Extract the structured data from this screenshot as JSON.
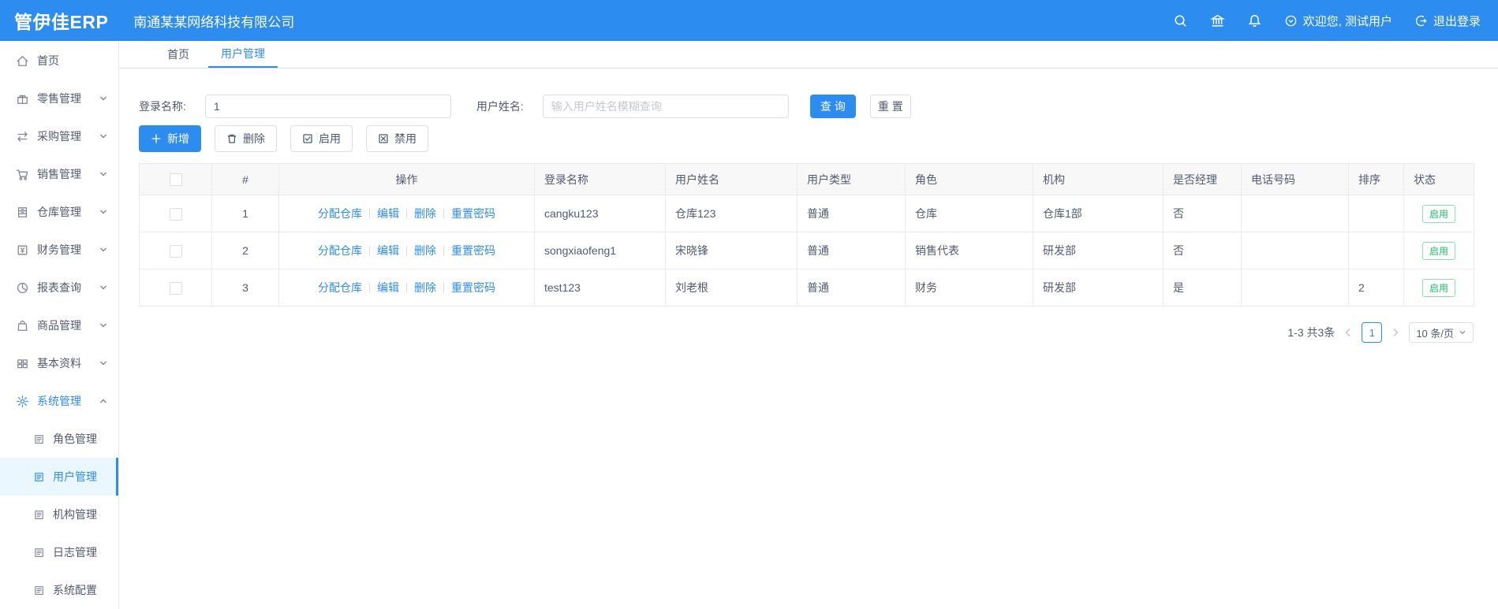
{
  "colors": {
    "accent": "#2d8cf0",
    "success": "#19be6b",
    "header_bg": "#2d8cf0"
  },
  "header": {
    "logo": "管伊佳ERP",
    "company": "南通某某网络科技有限公司",
    "welcome": "欢迎您, 测试用户",
    "logout": "退出登录"
  },
  "sidebar": {
    "items": [
      {
        "id": "home",
        "label": "首页",
        "icon": "home-icon"
      },
      {
        "id": "retail",
        "label": "零售管理",
        "icon": "gift-icon",
        "chevron": "down"
      },
      {
        "id": "purchase",
        "label": "采购管理",
        "icon": "swap-icon",
        "chevron": "down"
      },
      {
        "id": "sales",
        "label": "销售管理",
        "icon": "cart-icon",
        "chevron": "down"
      },
      {
        "id": "warehouse",
        "label": "仓库管理",
        "icon": "warehouse-icon",
        "chevron": "down"
      },
      {
        "id": "finance",
        "label": "财务管理",
        "icon": "finance-icon",
        "chevron": "down"
      },
      {
        "id": "report",
        "label": "报表查询",
        "icon": "piechart-icon",
        "chevron": "down"
      },
      {
        "id": "product",
        "label": "商品管理",
        "icon": "bag-icon",
        "chevron": "down"
      },
      {
        "id": "basicdata",
        "label": "基本资料",
        "icon": "grid-icon",
        "chevron": "down"
      },
      {
        "id": "system",
        "label": "系统管理",
        "icon": "gear-icon",
        "chevron": "up",
        "active": true
      },
      {
        "id": "role",
        "label": "角色管理",
        "icon": "doc-icon",
        "sub": true
      },
      {
        "id": "user",
        "label": "用户管理",
        "icon": "doc-icon",
        "sub": true,
        "active": true
      },
      {
        "id": "org",
        "label": "机构管理",
        "icon": "doc-icon",
        "sub": true
      },
      {
        "id": "log",
        "label": "日志管理",
        "icon": "doc-icon",
        "sub": true
      },
      {
        "id": "config",
        "label": "系统配置",
        "icon": "doc-icon",
        "sub": true
      }
    ]
  },
  "tabs": [
    {
      "label": "首页",
      "active": false
    },
    {
      "label": "用户管理",
      "active": true
    }
  ],
  "search": {
    "login_label": "登录名称:",
    "login_value": "1",
    "name_label": "用户姓名:",
    "name_placeholder": "输入用户姓名模糊查询",
    "query_label": "查 询",
    "reset_label": "重 置"
  },
  "toolbar": {
    "add_label": "新增",
    "delete_label": "删除",
    "enable_label": "启用",
    "disable_label": "禁用"
  },
  "table": {
    "headers": [
      "#",
      "操作",
      "登录名称",
      "用户姓名",
      "用户类型",
      "角色",
      "机构",
      "是否经理",
      "电话号码",
      "排序",
      "状态"
    ],
    "action_links": [
      "分配仓库",
      "编辑",
      "删除",
      "重置密码"
    ],
    "rows": [
      {
        "index": "1",
        "login": "cangku123",
        "name": "仓库123",
        "type": "普通",
        "role": "仓库",
        "org": "仓库1部",
        "manager": "否",
        "phone": "",
        "sort": "",
        "status": "启用"
      },
      {
        "index": "2",
        "login": "songxiaofeng1",
        "name": "宋晓锋",
        "type": "普通",
        "role": "销售代表",
        "org": "研发部",
        "manager": "否",
        "phone": "",
        "sort": "",
        "status": "启用"
      },
      {
        "index": "3",
        "login": "test123",
        "name": "刘老根",
        "type": "普通",
        "role": "财务",
        "org": "研发部",
        "manager": "是",
        "phone": "",
        "sort": "2",
        "status": "启用"
      }
    ]
  },
  "pagination": {
    "total_text": "1-3 共3条",
    "page": "1",
    "page_size": "10 条/页"
  }
}
